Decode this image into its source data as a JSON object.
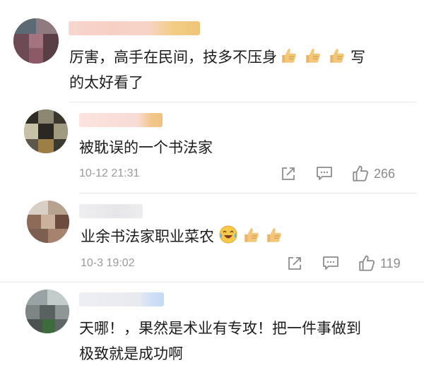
{
  "comments": [
    {
      "text": "厉害，高手在民间，技多不压身",
      "text_after_emoji": "写",
      "text_line2": "的太好看了"
    },
    {
      "text": "被耽误的一个书法家",
      "time": "10-12 21:31",
      "likes": "266"
    },
    {
      "text": "业余书法家职业菜农",
      "time": "10-3 19:02",
      "likes": "119"
    },
    {
      "text": "天哪！，果然是术业有专攻！把一件事做到",
      "text_line2": "极致就是成功啊"
    }
  ],
  "icons": {
    "reply": "reply-square-icon",
    "comment": "comment-bubble-icon",
    "like": "thumbs-up-icon",
    "thumbs_emoji": "thumbs-up-emoji",
    "laugh_emoji": "laughing-tears-emoji"
  }
}
